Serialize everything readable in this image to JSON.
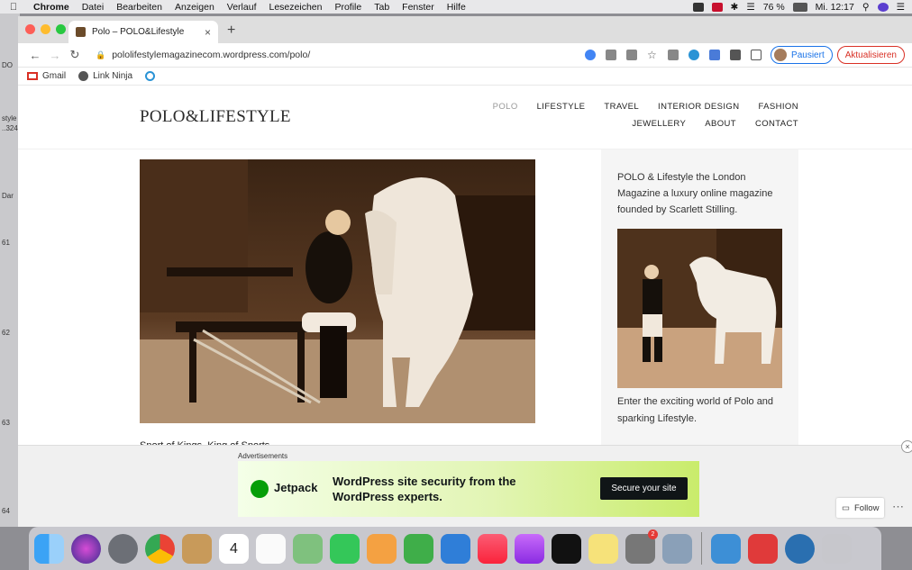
{
  "menubar": {
    "app_name": "Chrome",
    "items": [
      "Datei",
      "Bearbeiten",
      "Anzeigen",
      "Verlauf",
      "Lesezeichen",
      "Profile",
      "Tab",
      "Fenster",
      "Hilfe"
    ],
    "battery": "76 %",
    "clock": "Mi. 12:17"
  },
  "background_window": {
    "texts": [
      "DO",
      "style",
      "..324",
      "Dar",
      "61",
      "62",
      "63",
      "64"
    ]
  },
  "browser": {
    "tab_title": "Polo – POLO&Lifestyle",
    "url": "pololifestylemagazinecom.wordpress.com/polo/",
    "profile_label": "Pausiert",
    "update_label": "Aktualisieren",
    "bookmarks": [
      "Gmail",
      "Link Ninja"
    ]
  },
  "site": {
    "logo": "POLO&LIFESTYLE",
    "nav": [
      "POLO",
      "LIFESTYLE",
      "TRAVEL",
      "INTERIOR DESIGN",
      "FASHION",
      "JEWELLERY",
      "ABOUT",
      "CONTACT"
    ],
    "caption": "Sport of Kings, King of Sports",
    "sidebar_intro": "POLO & Lifestyle the London Magazine a luxury online magazine founded by Scarlett Stilling.",
    "sidebar_text": "Enter the exciting world of Polo and sparking Lifestyle."
  },
  "ad": {
    "label": "Advertisements",
    "brand": "Jetpack",
    "headline": "WordPress site security from the WordPress experts.",
    "cta": "Secure your site",
    "follow": "Follow"
  },
  "dock": {
    "calendar_day": "4",
    "badge_count": "2"
  },
  "colors": {
    "accent_blue": "#1a73e8",
    "update_red": "#d93025",
    "jetpack_green": "#069e08"
  }
}
